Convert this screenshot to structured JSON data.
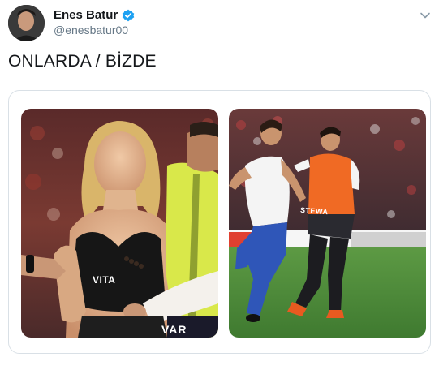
{
  "tweet": {
    "author": {
      "display_name": "Enes Batur",
      "handle": "@enesbatur00",
      "verified": true,
      "avatar_icon": "profile-avatar"
    },
    "text": "ONLARDA / BİZDE",
    "menu_icon": "chevron-down-icon",
    "media": {
      "left_photo": {
        "shirt_text": "VITA",
        "vest_text": "VAR"
      },
      "right_photo": {
        "vest_text": "STEWA"
      }
    }
  },
  "colors": {
    "text_primary": "#14171a",
    "text_secondary": "#657786",
    "verified_blue": "#1da1f2",
    "card_border": "#d9e0e6",
    "pitch_green": "#4e8a3a",
    "steward_orange": "#f06a24",
    "hi_vis_yellow": "#d9e84a"
  }
}
